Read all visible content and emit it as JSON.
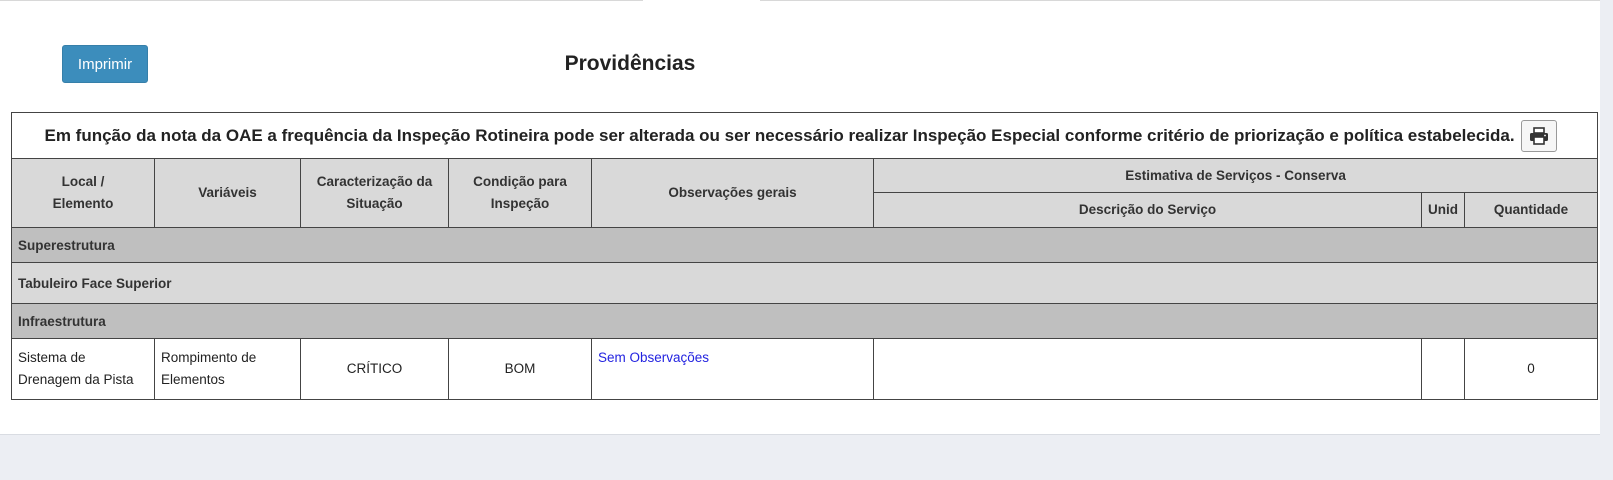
{
  "toolbar": {
    "print_label": "Imprimir"
  },
  "page": {
    "title": "Providências"
  },
  "notice": {
    "text": "Em função da nota da OAE a frequência da Inspeção Rotineira pode ser alterada ou ser necessário realizar Inspeção Especial conforme critério de priorização e política estabelecida.",
    "print_icon": "printer-icon"
  },
  "table": {
    "headers": {
      "local_line1": "Local /",
      "local_line2": "Elemento",
      "variaveis": "Variáveis",
      "caracterizacao_line1": "Caracterização da",
      "caracterizacao_line2": "Situação",
      "condicao_line1": "Condição para",
      "condicao_line2": "Inspeção",
      "observacoes": "Observações gerais",
      "estimativa": "Estimativa de Serviços - Conserva",
      "descricao": "Descrição do Serviço",
      "unid": "Unid",
      "quantidade": "Quantidade"
    },
    "sections": [
      "Superestrutura",
      "Tabuleiro Face Superior",
      "Infraestrutura"
    ],
    "rows": [
      {
        "local_line1": "Sistema de",
        "local_line2": "Drenagem da Pista",
        "variavel_line1": "Rompimento de",
        "variavel_line2": "Elementos",
        "caracterizacao": "CRÍTICO",
        "condicao": "BOM",
        "observacoes": "Sem Observações",
        "descricao": "",
        "unid": "",
        "quantidade": "0"
      }
    ]
  },
  "colors": {
    "button": "#3c8dbc",
    "header_bg": "#d9d9d9",
    "section_bg": "#bfbfbf",
    "link": "#2323e0"
  }
}
